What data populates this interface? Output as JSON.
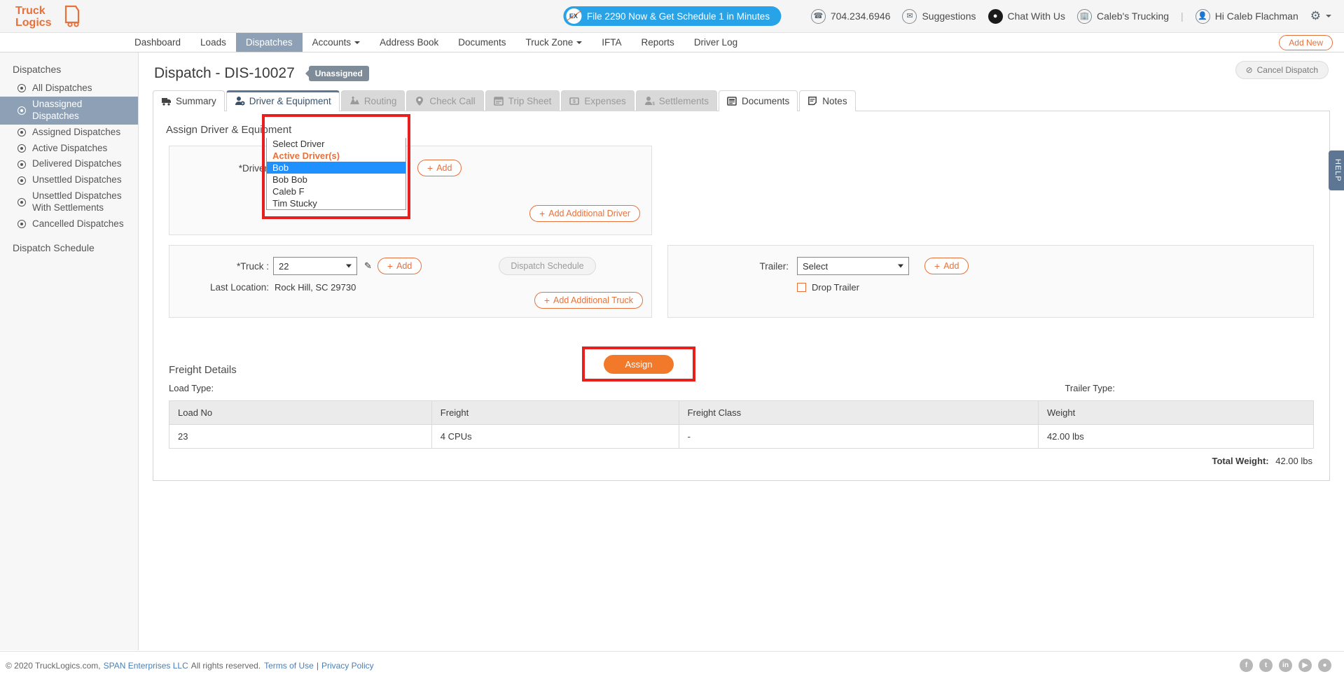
{
  "topbar": {
    "logo_line1": "Truck",
    "logo_line2": "Logics",
    "promo": "File 2290 Now & Get Schedule 1 in Minutes",
    "promo_badge": "EX",
    "phone": "704.234.6946",
    "suggestions": "Suggestions",
    "chat": "Chat With Us",
    "company": "Caleb's Trucking",
    "divider": "|",
    "user": "Hi Caleb Flachman"
  },
  "nav": {
    "items": [
      {
        "label": "Dashboard",
        "active": false,
        "caret": false
      },
      {
        "label": "Loads",
        "active": false,
        "caret": false
      },
      {
        "label": "Dispatches",
        "active": true,
        "caret": false
      },
      {
        "label": "Accounts",
        "active": false,
        "caret": true
      },
      {
        "label": "Address Book",
        "active": false,
        "caret": false
      },
      {
        "label": "Documents",
        "active": false,
        "caret": false
      },
      {
        "label": "Truck Zone",
        "active": false,
        "caret": true
      },
      {
        "label": "IFTA",
        "active": false,
        "caret": false
      },
      {
        "label": "Reports",
        "active": false,
        "caret": false
      },
      {
        "label": "Driver Log",
        "active": false,
        "caret": false
      }
    ],
    "add_new": "Add New"
  },
  "sidebar": {
    "heading": "Dispatches",
    "items": [
      {
        "label": "All Dispatches",
        "active": false
      },
      {
        "label": "Unassigned Dispatches",
        "active": true
      },
      {
        "label": "Assigned Dispatches",
        "active": false
      },
      {
        "label": "Active Dispatches",
        "active": false
      },
      {
        "label": "Delivered Dispatches",
        "active": false
      },
      {
        "label": "Unsettled Dispatches",
        "active": false
      },
      {
        "label": "Unsettled Dispatches With Settlements",
        "active": false
      },
      {
        "label": "Cancelled Dispatches",
        "active": false
      }
    ],
    "schedule": "Dispatch Schedule"
  },
  "page": {
    "title": "Dispatch - DIS-10027",
    "status": "Unassigned",
    "cancel_dispatch": "Cancel Dispatch",
    "help_tab": "HELP"
  },
  "tabs": [
    {
      "label": "Summary",
      "state": "enabled",
      "icon": "truck-icon"
    },
    {
      "label": "Driver & Equipment",
      "state": "active",
      "icon": "driver-gear-icon"
    },
    {
      "label": "Routing",
      "state": "disabled",
      "icon": "route-icon"
    },
    {
      "label": "Check Call",
      "state": "disabled",
      "icon": "map-pin-icon"
    },
    {
      "label": "Trip Sheet",
      "state": "disabled",
      "icon": "trip-sheet-icon"
    },
    {
      "label": "Expenses",
      "state": "disabled",
      "icon": "money-icon"
    },
    {
      "label": "Settlements",
      "state": "disabled",
      "icon": "settlement-icon"
    },
    {
      "label": "Documents",
      "state": "enabled",
      "icon": "document-icon"
    },
    {
      "label": "Notes",
      "state": "enabled",
      "icon": "note-icon"
    }
  ],
  "assign": {
    "section_title": "Assign Driver & Equipment",
    "driver_label": "*Driver",
    "driver_value": "Select Driver",
    "driver_add": "Add",
    "driver_options": [
      {
        "label": "Select Driver",
        "type": "option"
      },
      {
        "label": "Active Driver(s)",
        "type": "group"
      },
      {
        "label": "Bob",
        "type": "option",
        "selected": true
      },
      {
        "label": "Bob Bob",
        "type": "option"
      },
      {
        "label": "Caleb F",
        "type": "option"
      },
      {
        "label": "Tim Stucky",
        "type": "option"
      }
    ],
    "add_additional_driver": "Add Additional Driver",
    "truck_label": "*Truck :",
    "truck_value": "22",
    "truck_add": "Add",
    "dispatch_schedule": "Dispatch Schedule",
    "last_location_label": "Last Location:",
    "last_location_value": "Rock Hill, SC 29730",
    "add_additional_truck": "Add Additional Truck",
    "trailer_label": "Trailer:",
    "trailer_value": "Select",
    "trailer_add": "Add",
    "drop_trailer": "Drop Trailer",
    "assign_button": "Assign"
  },
  "freight": {
    "title": "Freight Details",
    "load_type_label": "Load Type:",
    "trailer_type_label": "Trailer Type:",
    "columns": [
      "Load No",
      "Freight",
      "Freight Class",
      "Weight"
    ],
    "rows": [
      [
        "23",
        "4 CPUs",
        "-",
        "42.00 lbs"
      ]
    ],
    "total_label": "Total Weight:",
    "total_value": "42.00 lbs"
  },
  "footer": {
    "copyright": "© 2020 TruckLogics.com,",
    "company": "SPAN Enterprises LLC",
    "rights": "All rights reserved.",
    "terms": "Terms of Use",
    "sep": "|",
    "privacy": "Privacy Policy",
    "social": [
      "f",
      "t",
      "in",
      "▶",
      "●"
    ]
  },
  "colors": {
    "brand_orange": "#e8703a",
    "accent_blue": "#29a3e8",
    "nav_active": "#8da0b6",
    "highlight_red": "#e81f1f",
    "assign_orange": "#f3792a"
  }
}
